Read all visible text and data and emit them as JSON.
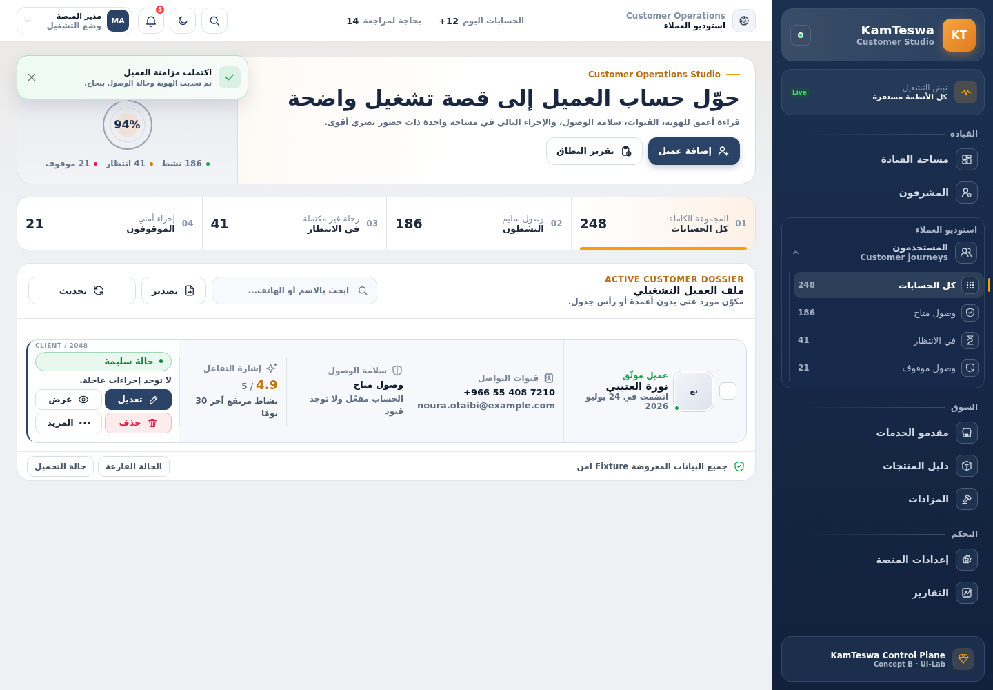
{
  "topbar": {
    "brand": {
      "title": "Customer Operations",
      "subtitle": "استوديو العملاء"
    },
    "stats": [
      {
        "label": "الحسابات اليوم",
        "value": "12+"
      },
      {
        "label": "بحاجة لمراجعة",
        "value": "14"
      }
    ],
    "notifications": "5",
    "user": {
      "initials": "MA",
      "name": "مدير المنصة",
      "role": "وضع التشغيل"
    }
  },
  "hero": {
    "eyebrow": "Customer Operations Studio",
    "title": "حوّل حساب العميل إلى قصة تشغيل واضحة",
    "subtitle": "قراءة أعمق للهوية، القنوات، سلامة الوصول، والإجراء التالي في مساحة واحدة ذات حضور بصري أقوى.",
    "buttons": [
      {
        "label": "إضافة عميل",
        "kind": "primary"
      },
      {
        "label": "تقرير النطاق",
        "kind": "secondary"
      }
    ],
    "gauge": {
      "value": "94%",
      "level": 0.94
    },
    "legend": [
      {
        "text": "186 نشط",
        "color": "#16a34a"
      },
      {
        "text": "41 انتظار",
        "color": "#d97706"
      },
      {
        "text": "21 موقوف",
        "color": "#e11d48"
      }
    ]
  },
  "toast": {
    "title": "اكتملت مزامنة العميل",
    "message": "تم تحديث الهوية وحالة الوصول بنجاح."
  },
  "stat_tabs": [
    {
      "index": "01",
      "caption": "المجموعة الكاملة",
      "label": "كل الحسابات",
      "value": "248",
      "selected": true
    },
    {
      "index": "02",
      "caption": "وصول سليم",
      "label": "النشطون",
      "value": "186",
      "selected": false
    },
    {
      "index": "03",
      "caption": "رحلة غير مكتملة",
      "label": "في الانتظار",
      "value": "41",
      "selected": false
    },
    {
      "index": "04",
      "caption": "إجراء أمني",
      "label": "الموقوفون",
      "value": "21",
      "selected": false
    }
  ],
  "dossier": {
    "eyebrow": "ACTIVE CUSTOMER DOSSIER",
    "title": "ملف العميل التشغيلي",
    "subtitle": "مكوّن مورد غني بدون أعمدة أو رأس جدول.",
    "search": {
      "placeholder": "ابحث بالاسم أو الهاتف..."
    },
    "buttons": [
      "تصدير",
      "تحديث"
    ],
    "client": {
      "checked": false,
      "initials": "نع",
      "online": true,
      "tag": "عميل موثّق",
      "name": "نورة العتيبي",
      "joined": "انضمت في 24 يوليو 2026",
      "channels": {
        "title": "قنوات التواصل",
        "phone": "+966 55 408 7210",
        "email": "noura.otaibi@example.com"
      },
      "access": {
        "title": "سلامة الوصول",
        "status": "وصول متاح",
        "note": "الحساب مفعّل ولا توجد قيود"
      },
      "engagement": {
        "title": "إشارة التفاعل",
        "score": "4.9",
        "scale": "/ 5",
        "note": "نشاط مرتفع آخر 30 يومًا"
      },
      "status": {
        "code": "CLIENT / 2048",
        "label": "حالة سليمة",
        "note": "لا توجد إجراءات عاجلة.",
        "actions": [
          {
            "label": "تعديل",
            "kind": "primary"
          },
          {
            "label": "عرض",
            "kind": "secondary"
          },
          {
            "label": "حذف",
            "kind": "danger"
          },
          {
            "label": "المزيد",
            "kind": "secondary"
          }
        ]
      }
    },
    "footer": {
      "note": "جميع البيانات المعروضة Fixture آمن",
      "buttons": [
        "الحالة الفارغة",
        "حالة التحميل"
      ]
    }
  },
  "sidebar": {
    "brand": {
      "initials": "KT",
      "name": "KamTeswa",
      "subtitle": "Customer Studio"
    },
    "pulse": {
      "label": "نبض التشغيل",
      "status": "كل الأنظمة مستقرة",
      "badge": "Live"
    },
    "sections": [
      {
        "title": "القيادة",
        "items": [
          {
            "label": "مساحة القيادة"
          },
          {
            "label": "المشرفون"
          }
        ]
      },
      {
        "title": "استوديو العملاء",
        "group": {
          "label": "المستخدمون",
          "subtitle": "Customer journeys",
          "expanded": true,
          "children": [
            {
              "label": "كل الحسابات",
              "count": "248",
              "selected": true
            },
            {
              "label": "وصول متاح",
              "count": "186",
              "selected": false
            },
            {
              "label": "في الانتظار",
              "count": "41",
              "selected": false
            },
            {
              "label": "وصول موقوف",
              "count": "21",
              "selected": false
            }
          ]
        }
      },
      {
        "title": "السوق",
        "items": [
          {
            "label": "مقدمو الخدمات"
          },
          {
            "label": "دليل المنتجات"
          },
          {
            "label": "المزادات"
          }
        ]
      },
      {
        "title": "التحكم",
        "items": [
          {
            "label": "إعدادات المنصة"
          },
          {
            "label": "التقارير"
          }
        ]
      }
    ],
    "footer": {
      "title": "KamTeswa Control Plane",
      "subtitle": "Concept B · UI-Lab"
    }
  }
}
